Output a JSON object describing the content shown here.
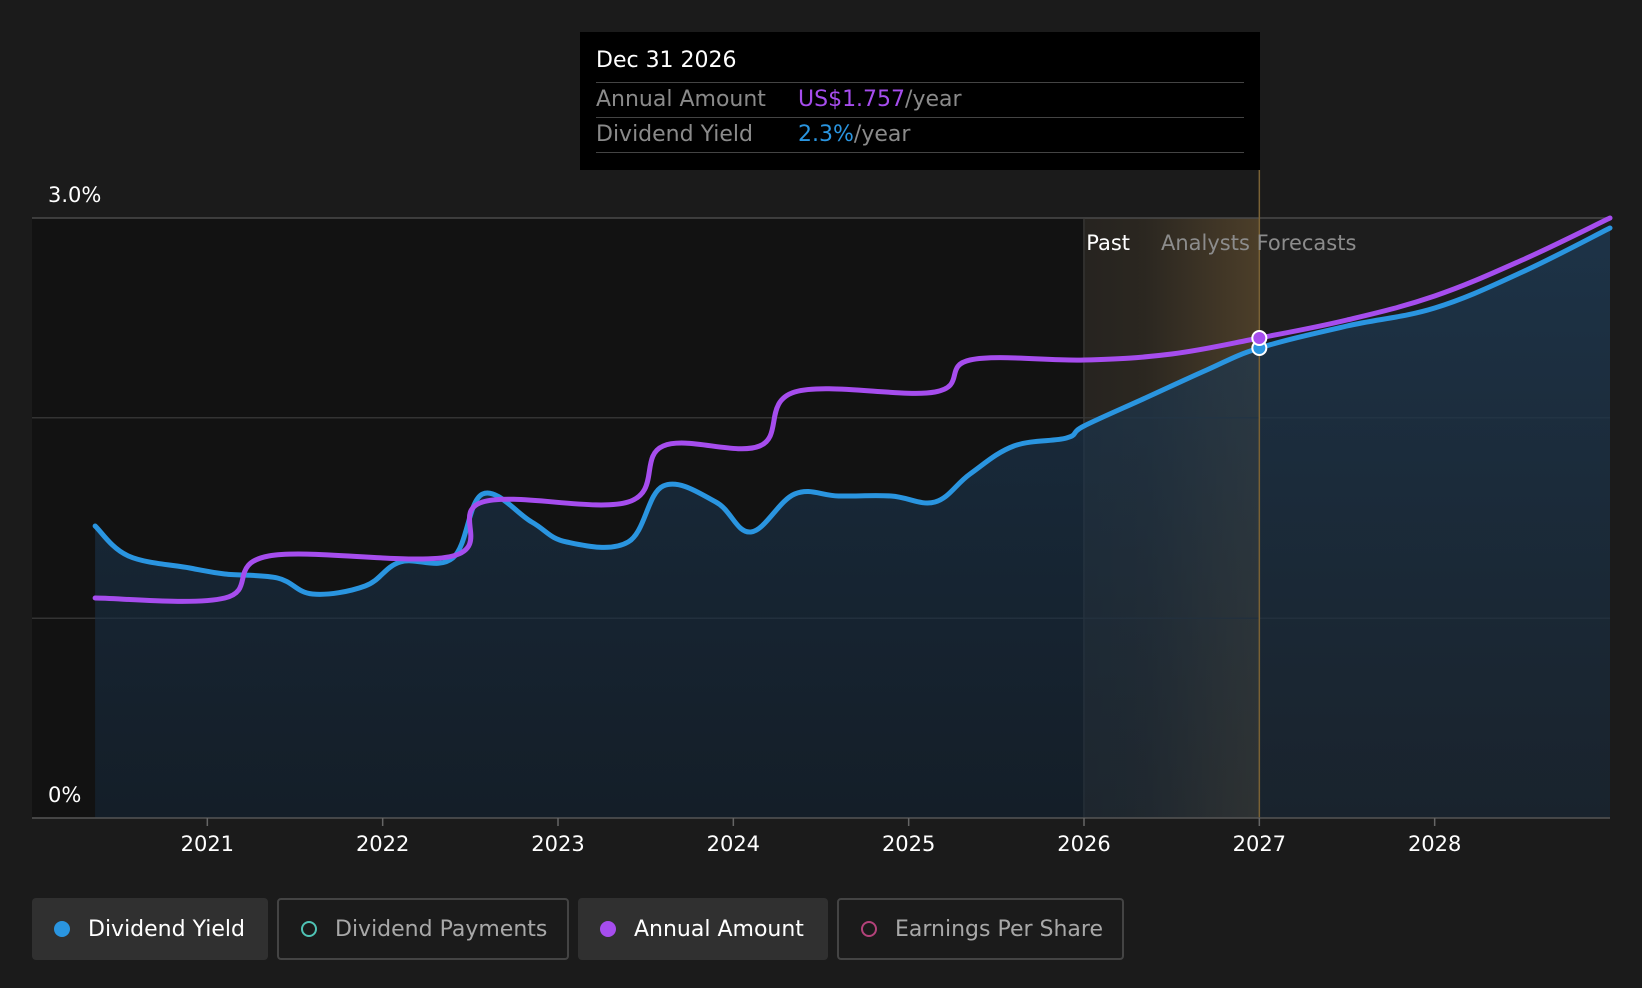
{
  "tooltip": {
    "date": "Dec 31 2026",
    "rows": [
      {
        "label": "Annual Amount",
        "value": "US$1.757",
        "unit": "/year"
      },
      {
        "label": "Dividend Yield",
        "value": "2.3%",
        "unit": "/year"
      }
    ]
  },
  "legend": [
    {
      "label": "Dividend Yield",
      "color": "#2a95e0",
      "filled": true,
      "active": true
    },
    {
      "label": "Dividend Payments",
      "color": "#4fc3b5",
      "filled": false,
      "active": false
    },
    {
      "label": "Annual Amount",
      "color": "#a64dee",
      "filled": true,
      "active": true
    },
    {
      "label": "Earnings Per Share",
      "color": "#b3427a",
      "filled": false,
      "active": false
    }
  ],
  "colors": {
    "background": "#1b1b1b",
    "yield_line": "#2a95e0",
    "annual_line": "#a64dee",
    "forecast_band": "#6b5431"
  },
  "chart_data": {
    "type": "line",
    "title": "",
    "xlabel": "",
    "ylabel": "",
    "ylim": [
      0,
      3.0
    ],
    "xlim": [
      2020.0,
      2029.0
    ],
    "y_axis_labels": [
      "0%",
      "3.0%"
    ],
    "x_tick_labels": [
      "2021",
      "2022",
      "2023",
      "2024",
      "2025",
      "2026",
      "2027",
      "2028"
    ],
    "region_labels": {
      "past": "Past",
      "forecast": "Analysts Forecasts"
    },
    "past_end": 2026.0,
    "hover_date": 2027.0,
    "grid": true,
    "series": [
      {
        "name": "Dividend Yield",
        "unit": "%",
        "points": [
          [
            2020.36,
            1.46
          ],
          [
            2020.55,
            1.31
          ],
          [
            2020.9,
            1.25
          ],
          [
            2021.1,
            1.22
          ],
          [
            2021.4,
            1.2
          ],
          [
            2021.6,
            1.12
          ],
          [
            2021.9,
            1.16
          ],
          [
            2022.1,
            1.28
          ],
          [
            2022.4,
            1.3
          ],
          [
            2022.57,
            1.62
          ],
          [
            2022.85,
            1.48
          ],
          [
            2023.05,
            1.38
          ],
          [
            2023.4,
            1.38
          ],
          [
            2023.6,
            1.66
          ],
          [
            2023.9,
            1.58
          ],
          [
            2024.1,
            1.43
          ],
          [
            2024.35,
            1.62
          ],
          [
            2024.6,
            1.61
          ],
          [
            2024.9,
            1.61
          ],
          [
            2025.15,
            1.58
          ],
          [
            2025.35,
            1.72
          ],
          [
            2025.6,
            1.86
          ],
          [
            2025.9,
            1.9
          ],
          [
            2026.0,
            1.96
          ],
          [
            2026.35,
            2.1
          ],
          [
            2026.7,
            2.24
          ],
          [
            2027.0,
            2.35
          ],
          [
            2027.5,
            2.46
          ],
          [
            2028.0,
            2.55
          ],
          [
            2028.5,
            2.73
          ],
          [
            2029.0,
            2.95
          ]
        ]
      },
      {
        "name": "Annual Amount",
        "unit": "US$",
        "points": [
          [
            2020.36,
            1.1
          ],
          [
            2021.1,
            1.1
          ],
          [
            2021.35,
            1.31
          ],
          [
            2022.4,
            1.31
          ],
          [
            2022.57,
            1.58
          ],
          [
            2023.4,
            1.58
          ],
          [
            2023.6,
            1.86
          ],
          [
            2024.15,
            1.86
          ],
          [
            2024.35,
            2.13
          ],
          [
            2025.15,
            2.13
          ],
          [
            2025.35,
            2.29
          ],
          [
            2026.0,
            2.29
          ],
          [
            2026.5,
            2.32
          ],
          [
            2027.0,
            2.4
          ],
          [
            2027.5,
            2.49
          ],
          [
            2028.0,
            2.61
          ],
          [
            2028.5,
            2.79
          ],
          [
            2029.0,
            3.0
          ]
        ]
      }
    ]
  }
}
